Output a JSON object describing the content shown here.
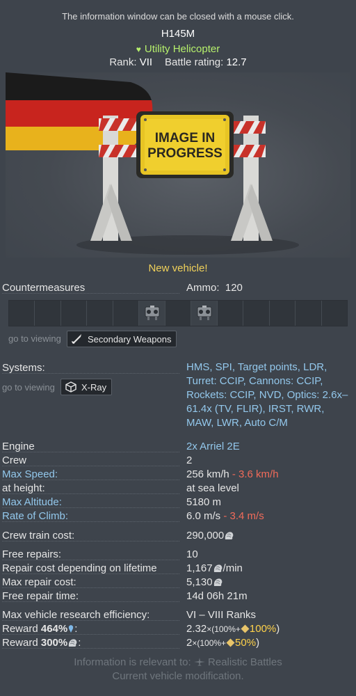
{
  "header": {
    "close_hint": "The information window can be closed with a mouse click.",
    "vehicle_name": "H145M",
    "vehicle_class": "Utility Helicopter",
    "rank_label": "Rank:",
    "rank_value": "VII",
    "br_label": "Battle rating:",
    "br_value": "12.7"
  },
  "image": {
    "sign_text_line1": "IMAGE IN",
    "sign_text_line2": "PROGRESS"
  },
  "new_vehicle_label": "New vehicle!",
  "countermeasures": {
    "label": "Countermeasures",
    "ammo_label": "Ammo:",
    "ammo_value": "120",
    "slots_total": 13,
    "filled_slots": [
      5,
      7
    ]
  },
  "secondary": {
    "goto_label": "go to viewing",
    "button_label": "Secondary Weapons"
  },
  "systems": {
    "label": "Systems:",
    "goto_label": "go to viewing",
    "xray_label": "X-Ray",
    "value": "HMS, SPI, Target points, LDR, Turret:  CCIP, Cannons:  CCIP, Rockets:  CCIP, NVD, Optics: 2.6x–61.4x (TV, FLIR), IRST, RWR, MAW, LWR, Auto C/M"
  },
  "specs": {
    "engine_label": "Engine",
    "engine_value": "2x  Arriel 2E",
    "crew_label": "Crew",
    "crew_value": "2",
    "max_speed_label": "Max Speed:",
    "max_speed_value": "256 km/h",
    "max_speed_penalty": "- 3.6 km/h",
    "height_label": "at height:",
    "height_value": "at sea level",
    "max_alt_label": "Max Altitude:",
    "max_alt_value": "5180 m",
    "climb_label": "Rate of Climb:",
    "climb_value": "6.0 m/s",
    "climb_penalty": "- 3.4 m/s"
  },
  "economy": {
    "crew_train_label": "Crew train cost:",
    "crew_train_value": "290,000",
    "free_repairs_label": "Free repairs:",
    "free_repairs_value": "10",
    "repair_lifetime_label": "Repair cost depending on lifetime",
    "repair_lifetime_value": "1,167",
    "repair_lifetime_unit": "/min",
    "max_repair_label": "Max repair cost:",
    "max_repair_value": "5,130",
    "free_repair_time_label": "Free repair time:",
    "free_repair_time_value": "14d 06h 21m",
    "research_eff_label": "Max vehicle research efficiency:",
    "research_eff_value": "VI – VIII Ranks",
    "reward_rp_label_a": "Reward ",
    "reward_rp_pct": "464%",
    "reward_rp_value_a": "2.32",
    "reward_rp_value_b": "×(100%+",
    "reward_rp_bonus": "100%",
    "reward_rp_close": ")",
    "reward_sl_label_a": "Reward ",
    "reward_sl_pct": "300%",
    "reward_sl_value_a": "2",
    "reward_sl_value_b": "×(100%+",
    "reward_sl_bonus": "50%",
    "reward_sl_close": ")"
  },
  "footer": {
    "line1_prefix": "Information is relevant to:",
    "line1_mode": "Realistic Battles",
    "line2": "Current vehicle modification."
  },
  "colors": {
    "background": "#3e444c",
    "class_green": "#b6f06c",
    "new_yellow": "#f1d25a",
    "param_blue": "#93c8ec",
    "penalty_red": "#f06b5a",
    "bonus_gold": "#ffd24a"
  }
}
